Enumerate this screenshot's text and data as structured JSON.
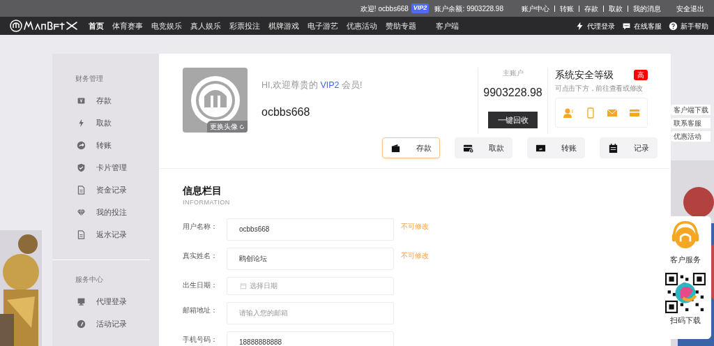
{
  "top_bar": {
    "welcome": "欢迎!",
    "username": "ocbbs668",
    "vip": "VIP2",
    "balance_label": "账户余额:",
    "balance": "9903228.98",
    "links": [
      "账户中心",
      "转账",
      "存款",
      "取款",
      "我的消息"
    ],
    "logout": "安全退出"
  },
  "nav": {
    "items": [
      {
        "label": "首页",
        "selected": true
      },
      {
        "label": "体育赛事",
        "selected": false
      },
      {
        "label": "电竞娱乐",
        "selected": false
      },
      {
        "label": "真人娱乐",
        "selected": false
      },
      {
        "label": "彩票投注",
        "selected": false
      },
      {
        "label": "棋牌游戏",
        "selected": false
      },
      {
        "label": "电子游艺",
        "selected": false
      },
      {
        "label": "优惠活动",
        "selected": false
      },
      {
        "label": "赞助专题",
        "selected": false
      },
      {
        "label": "客户端",
        "selected": false
      }
    ],
    "right": [
      {
        "kind": "bolt",
        "label": "代理登录"
      },
      {
        "kind": "chat",
        "label": "在线客服"
      },
      {
        "kind": "help",
        "label": "新手帮助"
      }
    ]
  },
  "sidebar": {
    "groups": [
      {
        "title": "财务管理",
        "items": [
          {
            "kind": "yen",
            "label": "存款"
          },
          {
            "kind": "bolt",
            "label": "取款"
          },
          {
            "kind": "arrow",
            "label": "转账"
          },
          {
            "kind": "shield",
            "label": "卡片管理"
          },
          {
            "kind": "doc",
            "label": "资金记录"
          },
          {
            "kind": "gem",
            "label": "我的投注"
          },
          {
            "kind": "doc",
            "label": "返水记录"
          }
        ]
      },
      {
        "title": "服务中心",
        "items": [
          {
            "kind": "monitor",
            "label": "代理登录"
          },
          {
            "kind": "gauge",
            "label": "活动记录"
          }
        ]
      }
    ]
  },
  "profile": {
    "change_avatar": "更换头像",
    "greeting": {
      "prefix": "HI,欢迎尊贵的 ",
      "vip": "VIP2",
      "suffix": " 会员!"
    },
    "username": "ocbbs668"
  },
  "account": {
    "label": "主账户",
    "amount": "9903228.98",
    "button": "一键回收"
  },
  "security": {
    "title": "系统安全等级",
    "level_badge": "高",
    "hint": "可点击下方，前往查看或修改"
  },
  "actions": [
    {
      "kind": "wallet",
      "label": "存款",
      "selected": true
    },
    {
      "kind": "card",
      "label": "取款",
      "selected": false
    },
    {
      "kind": "transfer",
      "label": "转账",
      "selected": false
    },
    {
      "kind": "record",
      "label": "记录",
      "selected": false
    }
  ],
  "info": {
    "title": "信息栏目",
    "subtitle": "INFORMATION",
    "fields": [
      {
        "label": "用户名称：",
        "value": "ocbbs668",
        "note": "不可修改"
      },
      {
        "label": "真实姓名：",
        "value": "鸥创论坛",
        "note": "不可修改"
      },
      {
        "label": "出生日期：",
        "kind": "date",
        "placeholder": "选择日期"
      },
      {
        "label": "邮箱地址：",
        "placeholder": "请输入您的邮箱"
      },
      {
        "label": "手机号码：",
        "value": "18888888888"
      }
    ]
  },
  "float_tabs": [
    "客户端下载",
    "联系客服",
    "优惠活动"
  ],
  "service": {
    "title": "客户服务",
    "qr_label": "扫码下载"
  }
}
